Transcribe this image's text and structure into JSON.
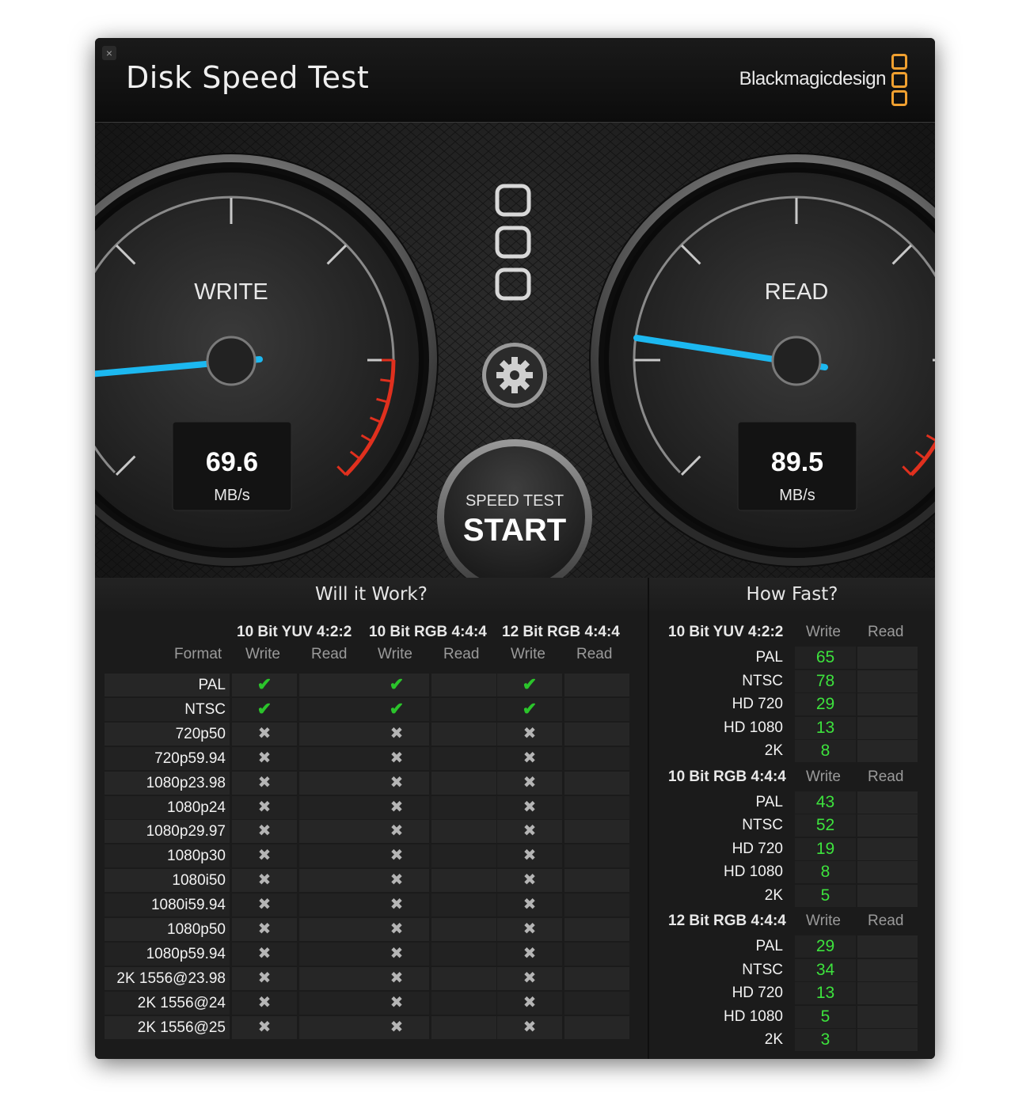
{
  "window": {
    "title": "Disk Speed Test",
    "close_glyph": "×",
    "brand": "Blackmagicdesign"
  },
  "gauges": {
    "write": {
      "label": "WRITE",
      "value": "69.6",
      "unit": "MB/s"
    },
    "read": {
      "label": "READ",
      "value": "89.5",
      "unit": "MB/s"
    }
  },
  "start_button": {
    "line1": "SPEED TEST",
    "line2": "START"
  },
  "settings_icon": "gear-icon",
  "will_it_work": {
    "title": "Will it Work?",
    "format_label": "Format",
    "groups": [
      "10 Bit YUV 4:2:2",
      "10 Bit RGB 4:4:4",
      "12 Bit RGB 4:4:4"
    ],
    "sub_write": "Write",
    "sub_read": "Read",
    "rows": [
      {
        "format": "PAL",
        "write": [
          true,
          true,
          true
        ]
      },
      {
        "format": "NTSC",
        "write": [
          true,
          true,
          true
        ]
      },
      {
        "format": "720p50",
        "write": [
          false,
          false,
          false
        ]
      },
      {
        "format": "720p59.94",
        "write": [
          false,
          false,
          false
        ]
      },
      {
        "format": "1080p23.98",
        "write": [
          false,
          false,
          false
        ]
      },
      {
        "format": "1080p24",
        "write": [
          false,
          false,
          false
        ]
      },
      {
        "format": "1080p29.97",
        "write": [
          false,
          false,
          false
        ]
      },
      {
        "format": "1080p30",
        "write": [
          false,
          false,
          false
        ]
      },
      {
        "format": "1080i50",
        "write": [
          false,
          false,
          false
        ]
      },
      {
        "format": "1080i59.94",
        "write": [
          false,
          false,
          false
        ]
      },
      {
        "format": "1080p50",
        "write": [
          false,
          false,
          false
        ]
      },
      {
        "format": "1080p59.94",
        "write": [
          false,
          false,
          false
        ]
      },
      {
        "format": "2K 1556@23.98",
        "write": [
          false,
          false,
          false
        ]
      },
      {
        "format": "2K 1556@24",
        "write": [
          false,
          false,
          false
        ]
      },
      {
        "format": "2K 1556@25",
        "write": [
          false,
          false,
          false
        ]
      }
    ]
  },
  "how_fast": {
    "title": "How Fast?",
    "sub_write": "Write",
    "sub_read": "Read",
    "sections": [
      {
        "name": "10 Bit YUV 4:2:2",
        "rows": [
          {
            "format": "PAL",
            "write": "65"
          },
          {
            "format": "NTSC",
            "write": "78"
          },
          {
            "format": "HD 720",
            "write": "29"
          },
          {
            "format": "HD 1080",
            "write": "13"
          },
          {
            "format": "2K",
            "write": "8"
          }
        ]
      },
      {
        "name": "10 Bit RGB 4:4:4",
        "rows": [
          {
            "format": "PAL",
            "write": "43"
          },
          {
            "format": "NTSC",
            "write": "52"
          },
          {
            "format": "HD 720",
            "write": "19"
          },
          {
            "format": "HD 1080",
            "write": "8"
          },
          {
            "format": "2K",
            "write": "5"
          }
        ]
      },
      {
        "name": "12 Bit RGB 4:4:4",
        "rows": [
          {
            "format": "PAL",
            "write": "29"
          },
          {
            "format": "NTSC",
            "write": "34"
          },
          {
            "format": "HD 720",
            "write": "13"
          },
          {
            "format": "HD 1080",
            "write": "5"
          },
          {
            "format": "2K",
            "write": "3"
          }
        ]
      }
    ]
  },
  "colors": {
    "needle": "#1cb8f0",
    "check": "#2bc42b",
    "value_green": "#3de23d",
    "redline": "#e0301e",
    "brand_orange": "#f0a030"
  }
}
